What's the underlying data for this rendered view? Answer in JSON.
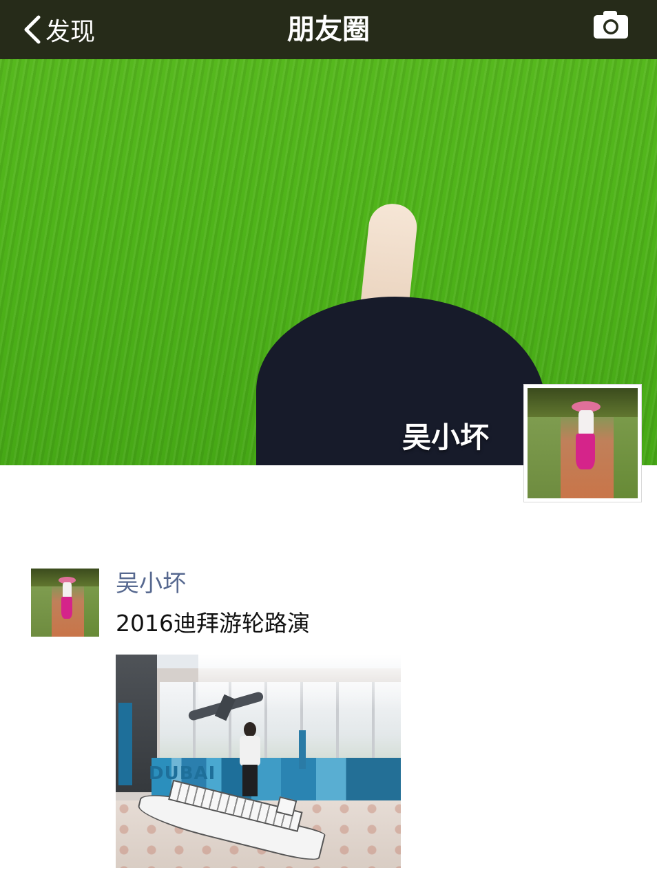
{
  "navbar": {
    "back_label": "发现",
    "title": "朋友圈",
    "back_icon": "chevron-left-icon",
    "camera_icon": "camera-icon",
    "background_color": "#262b19"
  },
  "cover": {
    "user_name": "吴小坏"
  },
  "post": {
    "author": "吴小坏",
    "text": "2016迪拜游轮路演",
    "image_sign_text": "DUBAI"
  }
}
